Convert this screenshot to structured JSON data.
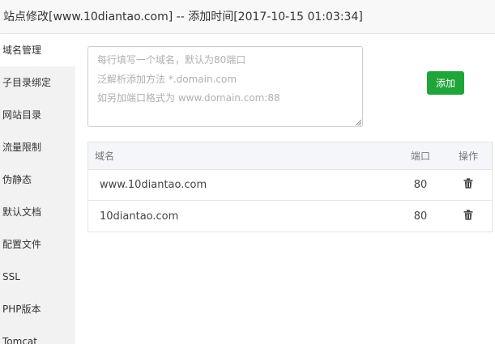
{
  "window": {
    "title": "站点修改[www.10diantao.com] -- 添加时间[2017-10-15 01:03:34]"
  },
  "sidebar": {
    "items": [
      {
        "label": "域名管理",
        "active": true
      },
      {
        "label": "子目录绑定"
      },
      {
        "label": "网站目录"
      },
      {
        "label": "流量限制"
      },
      {
        "label": "伪静态"
      },
      {
        "label": "默认文档"
      },
      {
        "label": "配置文件"
      },
      {
        "label": "SSL"
      },
      {
        "label": "PHP版本"
      },
      {
        "label": "Tomcat"
      }
    ]
  },
  "domain_form": {
    "placeholder_lines": [
      "每行填写一个域名，默认为80端口",
      "泛解析添加方法 *.domain.com",
      "如另加端口格式为 www.domain.com:88"
    ],
    "add_label": "添加"
  },
  "domain_table": {
    "headers": {
      "name": "域名",
      "port": "端口",
      "action": "操作"
    },
    "rows": [
      {
        "domain": "www.10diantao.com",
        "port": "80"
      },
      {
        "domain": "10diantao.com",
        "port": "80"
      }
    ]
  },
  "colors": {
    "accent": "#20a53a",
    "sidebar_bg": "#f2f2f2",
    "table_header_bg": "#f5f6fa"
  },
  "icons": {
    "delete": "trash-icon",
    "resize": "resize-grip-icon"
  }
}
